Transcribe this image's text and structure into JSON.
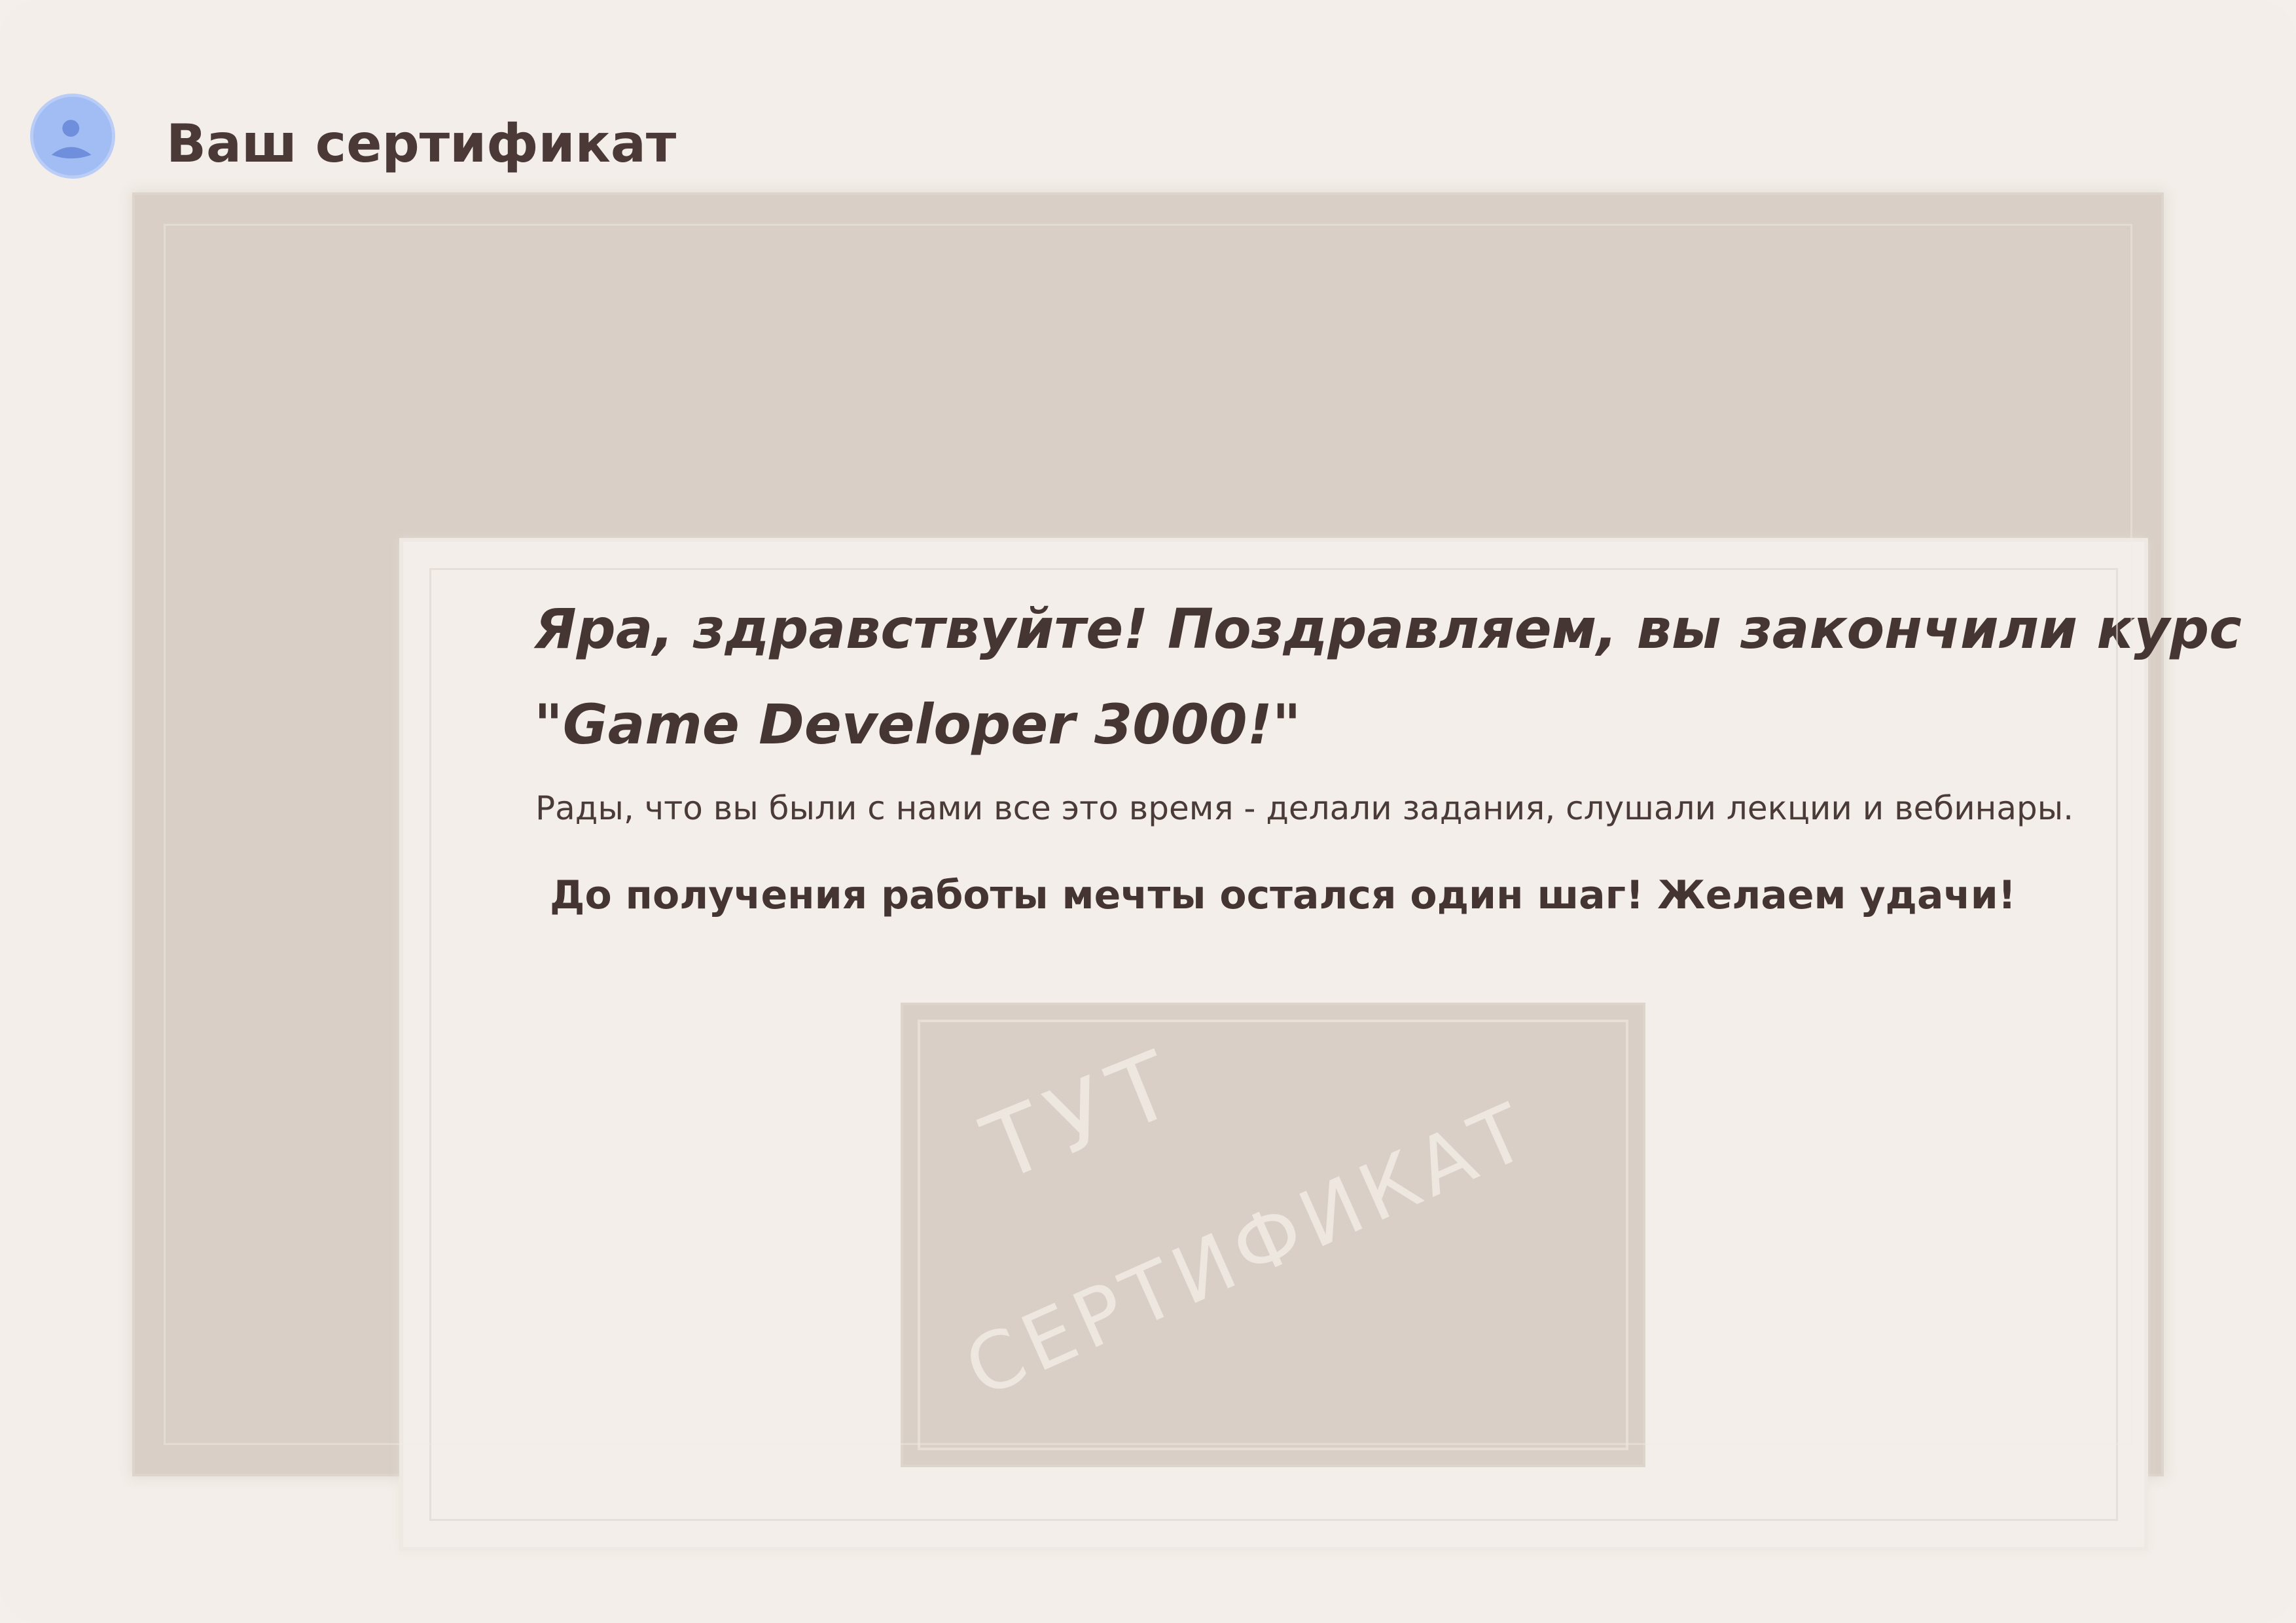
{
  "header": {
    "title": "Ваш сертификат",
    "avatar_icon": "user-avatar-icon"
  },
  "card": {
    "greeting_line1": "Яра, здравствуйте! Поздравляем, вы закончили курс",
    "greeting_line2": "\"Game Developer 3000!\"",
    "subtitle": "Рады, что вы были с нами все это время - делали задания, слушали лекции и вебинары.",
    "wish": "До получения работы мечты остался один шаг! Желаем удачи!"
  },
  "certificate": {
    "placeholder_line1": "ТУТ",
    "placeholder_line2": "СЕРТИФИКАТ"
  },
  "colors": {
    "background": "#f3eee9",
    "frame": "#d9cfc6",
    "text": "#453533",
    "avatar": "#9bb6f2"
  }
}
